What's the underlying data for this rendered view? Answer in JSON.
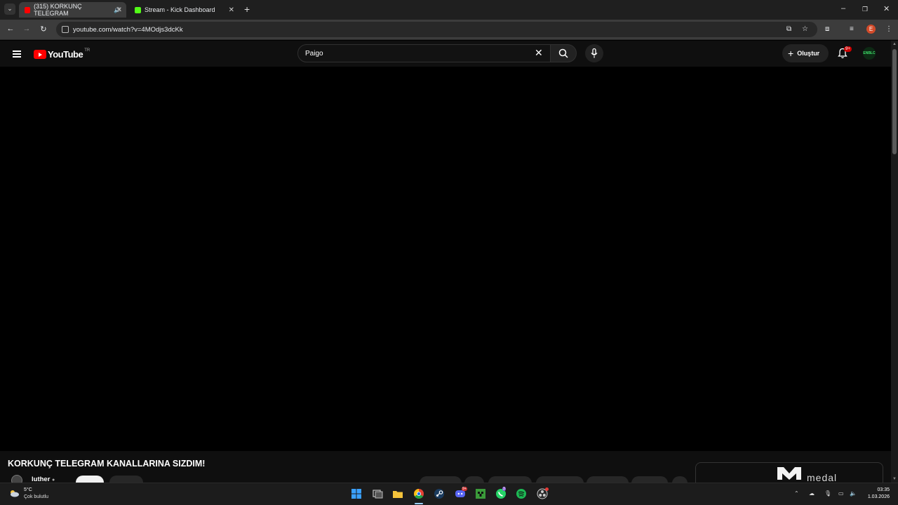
{
  "browser": {
    "tabs": [
      {
        "title": "(315) KORKUNÇ TELEGRAM",
        "active": true,
        "favicon_color": "#ff0000"
      },
      {
        "title": "Stream - Kick Dashboard",
        "active": false,
        "favicon_color": "#53fc18"
      }
    ],
    "new_tab_glyph": "+",
    "tab_list_glyph": "⌄",
    "address": "youtube.com/watch?v=4MOdjs3dcKk",
    "profile_initial": "E",
    "window_controls": {
      "minimize": "–",
      "restore": "❐",
      "close": "✕"
    }
  },
  "youtube": {
    "logo_text": "YouTube",
    "country_code": "TR",
    "search": {
      "value": "Paigo"
    },
    "create_label": "Oluştur",
    "notification_badge": "9+",
    "avatar_text": "ENBLC"
  },
  "video": {
    "title": "KORKUNÇ TELEGRAM KANALLARINA SIZDIM!",
    "channel_name": "luther",
    "overlay_brand": "medal"
  },
  "taskbar": {
    "weather": {
      "temp": "5°C",
      "desc": "Çok bulutlu"
    },
    "apps": [
      {
        "name": "windows-start",
        "color": "#3aa0ff"
      },
      {
        "name": "task-view",
        "color": "#9a9a9a"
      },
      {
        "name": "file-explorer",
        "color": "#f5c33b"
      },
      {
        "name": "chrome",
        "color": "#e44134"
      },
      {
        "name": "steam",
        "color": "#1b6fb3"
      },
      {
        "name": "discord",
        "color": "#5865f2"
      },
      {
        "name": "minecraft",
        "color": "#3b9b3a"
      },
      {
        "name": "whatsapp",
        "color": "#25d366"
      },
      {
        "name": "spotify",
        "color": "#1db954"
      },
      {
        "name": "obs",
        "color": "#555555"
      }
    ],
    "discord_badge": "9+",
    "whatsapp_badge": "3",
    "time": "03:35",
    "date": "1.03.2026"
  }
}
